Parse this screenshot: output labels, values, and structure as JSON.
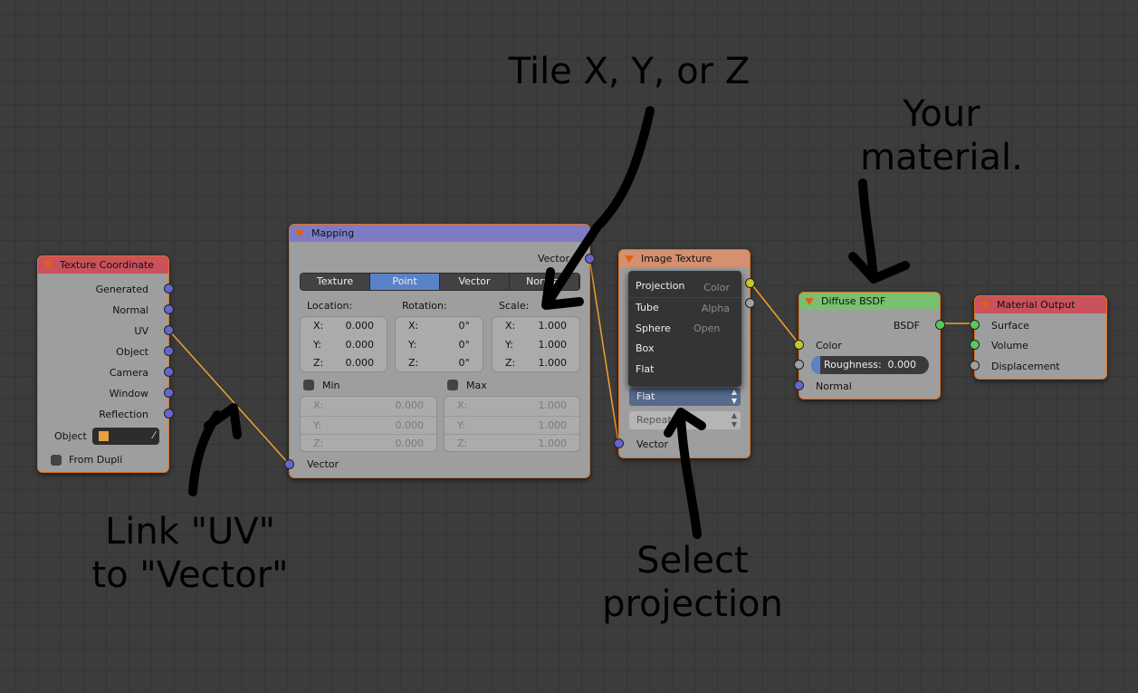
{
  "texture_coordinate": {
    "title": "Texture Coordinate",
    "outputs": [
      "Generated",
      "Normal",
      "UV",
      "Object",
      "Camera",
      "Window",
      "Reflection"
    ],
    "object_label": "Object",
    "from_dupli": "From Dupli"
  },
  "mapping": {
    "title": "Mapping",
    "output": "Vector",
    "tabs": [
      "Texture",
      "Point",
      "Vector",
      "Normal"
    ],
    "active_tab": "Point",
    "location_label": "Location:",
    "rotation_label": "Rotation:",
    "scale_label": "Scale:",
    "location": [
      {
        "k": "X:",
        "v": "0.000"
      },
      {
        "k": "Y:",
        "v": "0.000"
      },
      {
        "k": "Z:",
        "v": "0.000"
      }
    ],
    "rotation": [
      {
        "k": "X:",
        "v": "0°"
      },
      {
        "k": "Y:",
        "v": "0°"
      },
      {
        "k": "Z:",
        "v": "0°"
      }
    ],
    "scale": [
      {
        "k": "X:",
        "v": "1.000"
      },
      {
        "k": "Y:",
        "v": "1.000"
      },
      {
        "k": "Z:",
        "v": "1.000"
      }
    ],
    "min_label": "Min",
    "max_label": "Max",
    "min": [
      {
        "k": "X:",
        "v": "0.000"
      },
      {
        "k": "Y:",
        "v": "0.000"
      },
      {
        "k": "Z:",
        "v": "0.000"
      }
    ],
    "max": [
      {
        "k": "X:",
        "v": "1.000"
      },
      {
        "k": "Y:",
        "v": "1.000"
      },
      {
        "k": "Z:",
        "v": "1.000"
      }
    ],
    "input": "Vector"
  },
  "image_texture": {
    "title": "Image Texture",
    "outputs": [
      "Color",
      "Alpha"
    ],
    "open": "Open",
    "projection_value": "Flat",
    "extension_value": "Repeat",
    "input": "Vector",
    "menu": {
      "title": "Projection",
      "items": [
        "Tube",
        "Sphere",
        "Box",
        "Flat"
      ]
    }
  },
  "diffuse": {
    "title": "Diffuse BSDF",
    "output": "BSDF",
    "color": "Color",
    "roughness_label": "Roughness:",
    "roughness": "0.000",
    "normal": "Normal"
  },
  "material_output": {
    "title": "Material Output",
    "inputs": [
      "Surface",
      "Volume",
      "Displacement"
    ]
  },
  "annotations": {
    "tile": "Tile X, Y, or Z",
    "material": "Your\nmaterial.",
    "link": "Link \"UV\"\nto \"Vector\"",
    "select": "Select\nprojection"
  },
  "colors": {
    "link": "#f0a030",
    "node_border": "#e07020",
    "tex_coord_header": "#c9525c",
    "mapping_header": "#7d7bc4",
    "image_header": "#d49070",
    "diffuse_header": "#78c070",
    "output_header": "#c9525c"
  }
}
